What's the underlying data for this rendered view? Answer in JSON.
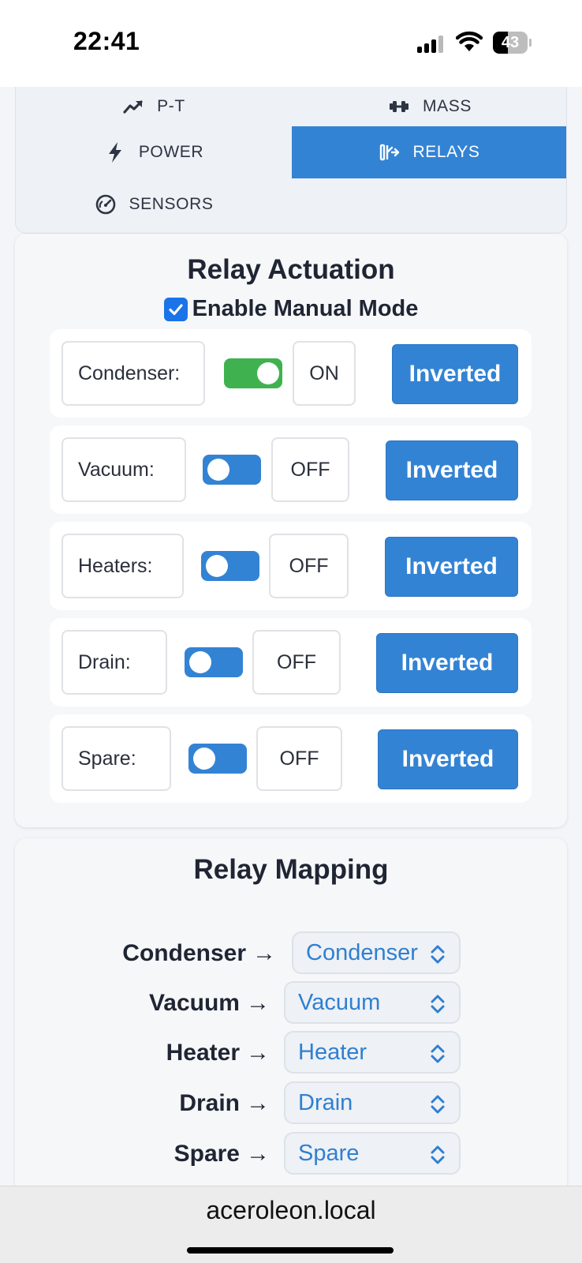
{
  "status_bar": {
    "time": "22:41",
    "battery": "43",
    "battery_level": 0.43,
    "signal_bars": 3,
    "icons": [
      "cellular-signal-icon",
      "wifi-icon",
      "battery-icon"
    ]
  },
  "tabs": [
    {
      "label": "P-T",
      "icon": "trend-up-icon",
      "active": false
    },
    {
      "label": "MASS",
      "icon": "dumbbell-icon",
      "active": false
    },
    {
      "label": "POWER",
      "icon": "lightning-bolt-icon",
      "active": false
    },
    {
      "label": "RELAYS",
      "icon": "relay-switch-icon",
      "active": true
    },
    {
      "label": "SENSORS",
      "icon": "gauge-icon",
      "active": false
    }
  ],
  "relay_actuation": {
    "title": "Relay Actuation",
    "manual_mode_label": "Enable Manual Mode",
    "manual_mode_checked": true,
    "relays": [
      {
        "name": "Condenser:",
        "on": true,
        "state": "ON",
        "button": "Inverted"
      },
      {
        "name": "Vacuum:",
        "on": false,
        "state": "OFF",
        "button": "Inverted"
      },
      {
        "name": "Heaters:",
        "on": false,
        "state": "OFF",
        "button": "Inverted"
      },
      {
        "name": "Drain:",
        "on": false,
        "state": "OFF",
        "button": "Inverted"
      },
      {
        "name": "Spare:",
        "on": false,
        "state": "OFF",
        "button": "Inverted"
      }
    ]
  },
  "relay_mapping": {
    "title": "Relay Mapping",
    "arrow": "→",
    "rows": [
      {
        "label": "Condenser",
        "value": "Condenser"
      },
      {
        "label": "Vacuum",
        "value": "Vacuum"
      },
      {
        "label": "Heater",
        "value": "Heater"
      },
      {
        "label": "Drain",
        "value": "Drain"
      },
      {
        "label": "Spare",
        "value": "Spare"
      }
    ]
  },
  "browser": {
    "url": "aceroleon.local"
  },
  "colors": {
    "accent": "#3383d4",
    "toggle_on": "#3fb24f",
    "select_text": "#2f7fd1",
    "checkbox": "#1a73e8"
  }
}
